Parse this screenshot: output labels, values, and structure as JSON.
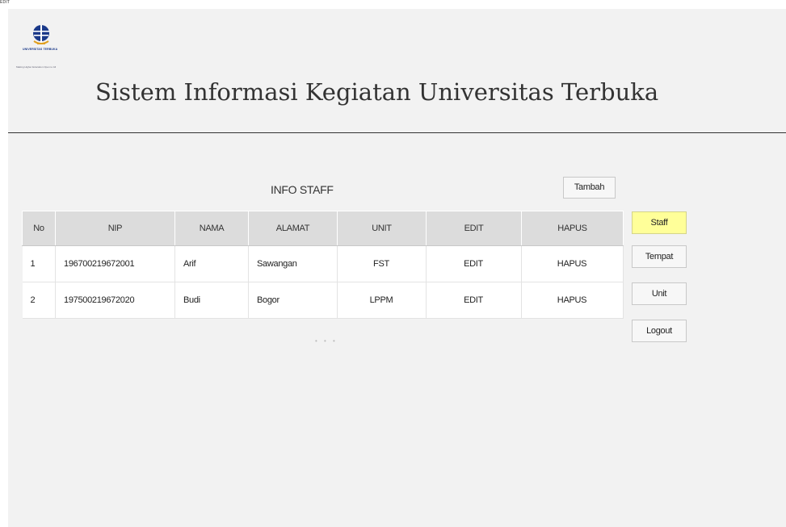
{
  "window": {
    "corner_label": "EDIT"
  },
  "header": {
    "logo_caption": "UNIVERSITAS TERBUKA",
    "logo_tagline": "Making Higher Education Open to All",
    "title": "Sistem Informasi Kegiatan Universitas Terbuka"
  },
  "main": {
    "section_title": "INFO STAFF",
    "add_button": "Tambah",
    "table": {
      "columns": [
        "No",
        "NIP",
        "NAMA",
        "ALAMAT",
        "UNIT",
        "EDIT",
        "HAPUS"
      ],
      "rows": [
        {
          "no": "1",
          "nip": "196700219672001",
          "nama": "Arif",
          "alamat": "Sawangan",
          "unit": "FST",
          "edit": "EDIT",
          "hapus": "HAPUS"
        },
        {
          "no": "2",
          "nip": "197500219672020",
          "nama": "Budi",
          "alamat": "Bogor",
          "unit": "LPPM",
          "edit": "EDIT",
          "hapus": "HAPUS"
        }
      ]
    },
    "more_indicator": "• • •"
  },
  "sidebar": {
    "items": [
      {
        "label": "Staff",
        "active": true
      },
      {
        "label": "Tempat",
        "active": false
      },
      {
        "label": "Unit",
        "active": false
      },
      {
        "label": "Logout",
        "active": false
      }
    ]
  },
  "colors": {
    "active_button": "#ffff99",
    "header_cell": "#dcdcdc",
    "canvas_bg": "#f2f2f2"
  }
}
